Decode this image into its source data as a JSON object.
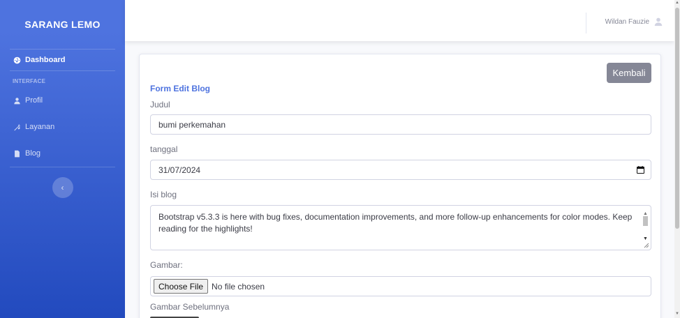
{
  "brand": "SARANG LEMO",
  "sidebar": {
    "dashboard": {
      "label": "Dashboard",
      "icon": "tachometer-icon"
    },
    "heading": "INTERFACE",
    "items": [
      {
        "label": "Profil",
        "icon": "user-icon"
      },
      {
        "label": "Layanan",
        "icon": "tools-icon"
      },
      {
        "label": "Blog",
        "icon": "file-icon"
      }
    ],
    "toggle_glyph": "‹"
  },
  "topbar": {
    "user_name": "Wildan Fauzie"
  },
  "form": {
    "back_label": "Kembali",
    "title": "Form Edit Blog",
    "judul_label": "Judul",
    "judul_value": "bumi perkemahan",
    "tanggal_label": "tanggal",
    "tanggal_value": "31/07/2024",
    "isi_label": "Isi blog",
    "isi_value": "Bootstrap v5.3.3 is here with bug fixes, documentation improvements, and more follow-up enhancements for color modes. Keep reading for the highlights!",
    "gambar_label": "Gambar:",
    "choose_file_label": "Choose File",
    "no_file_label": "No file chosen",
    "gambar_sebelumnya_label": "Gambar Sebelumnya"
  },
  "colors": {
    "primary": "#4e73df",
    "secondary": "#858796"
  }
}
